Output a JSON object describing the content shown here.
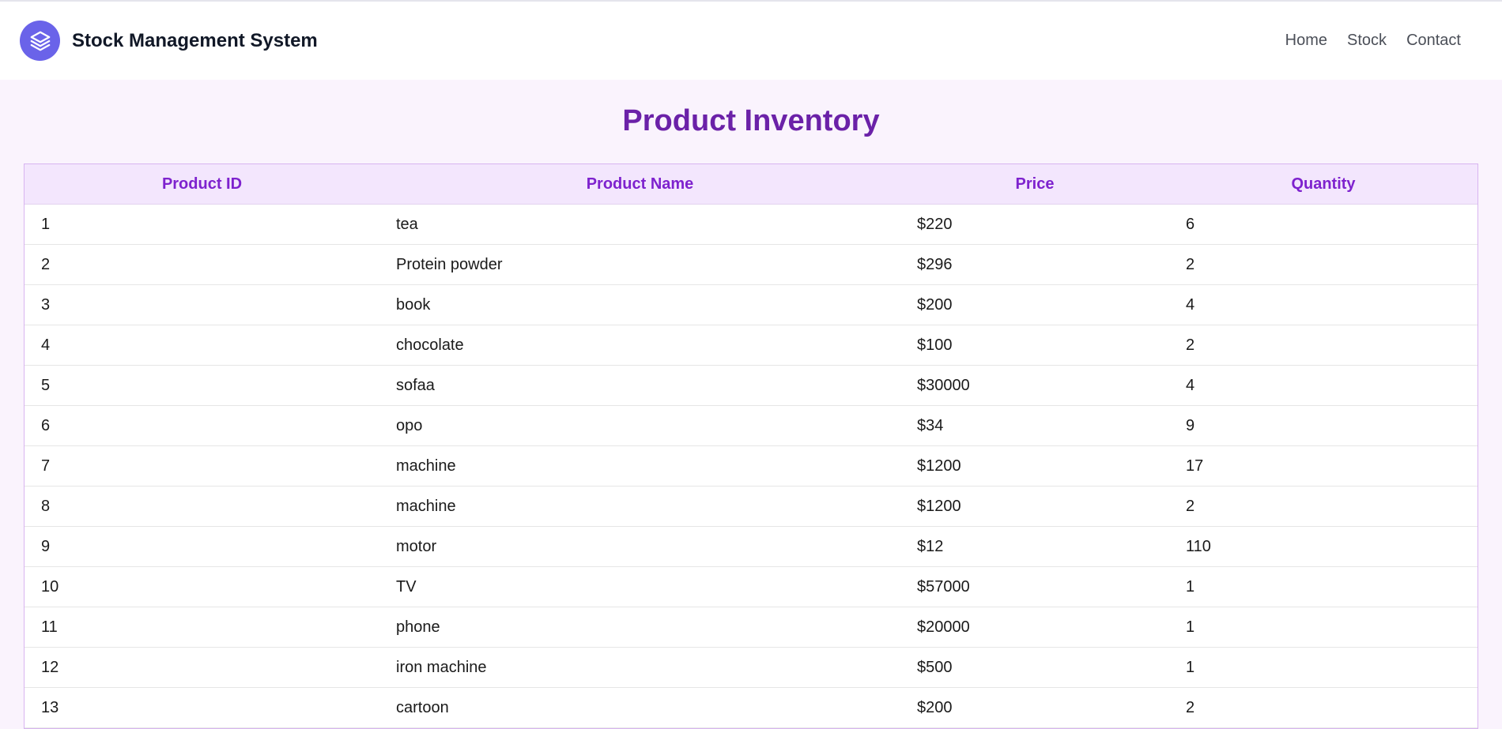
{
  "navbar": {
    "brand_title": "Stock Management System",
    "logo_icon": "layers-icon",
    "links": [
      "Home",
      "Stock",
      "Contact"
    ]
  },
  "colors": {
    "accent": "#6b21a8",
    "header_text": "#7e22ce",
    "logo_bg": "#6a63e9",
    "page_bg": "#faf3fd",
    "table_header_bg": "#f3e6fd"
  },
  "main": {
    "title": "Product Inventory",
    "table": {
      "headers": [
        "Product ID",
        "Product Name",
        "Price",
        "Quantity"
      ],
      "rows": [
        [
          "1",
          "tea",
          "$220",
          "6"
        ],
        [
          "2",
          "Protein powder",
          "$296",
          "2"
        ],
        [
          "3",
          "book",
          "$200",
          "4"
        ],
        [
          "4",
          "chocolate",
          "$100",
          "2"
        ],
        [
          "5",
          "sofaa",
          "$30000",
          "4"
        ],
        [
          "6",
          "opo",
          "$34",
          "9"
        ],
        [
          "7",
          "machine",
          "$1200",
          "17"
        ],
        [
          "8",
          "machine",
          "$1200",
          "2"
        ],
        [
          "9",
          "motor",
          "$12",
          "110"
        ],
        [
          "10",
          "TV",
          "$57000",
          "1"
        ],
        [
          "11",
          "phone",
          "$20000",
          "1"
        ],
        [
          "12",
          "iron machine",
          "$500",
          "1"
        ],
        [
          "13",
          "cartoon",
          "$200",
          "2"
        ]
      ]
    }
  }
}
